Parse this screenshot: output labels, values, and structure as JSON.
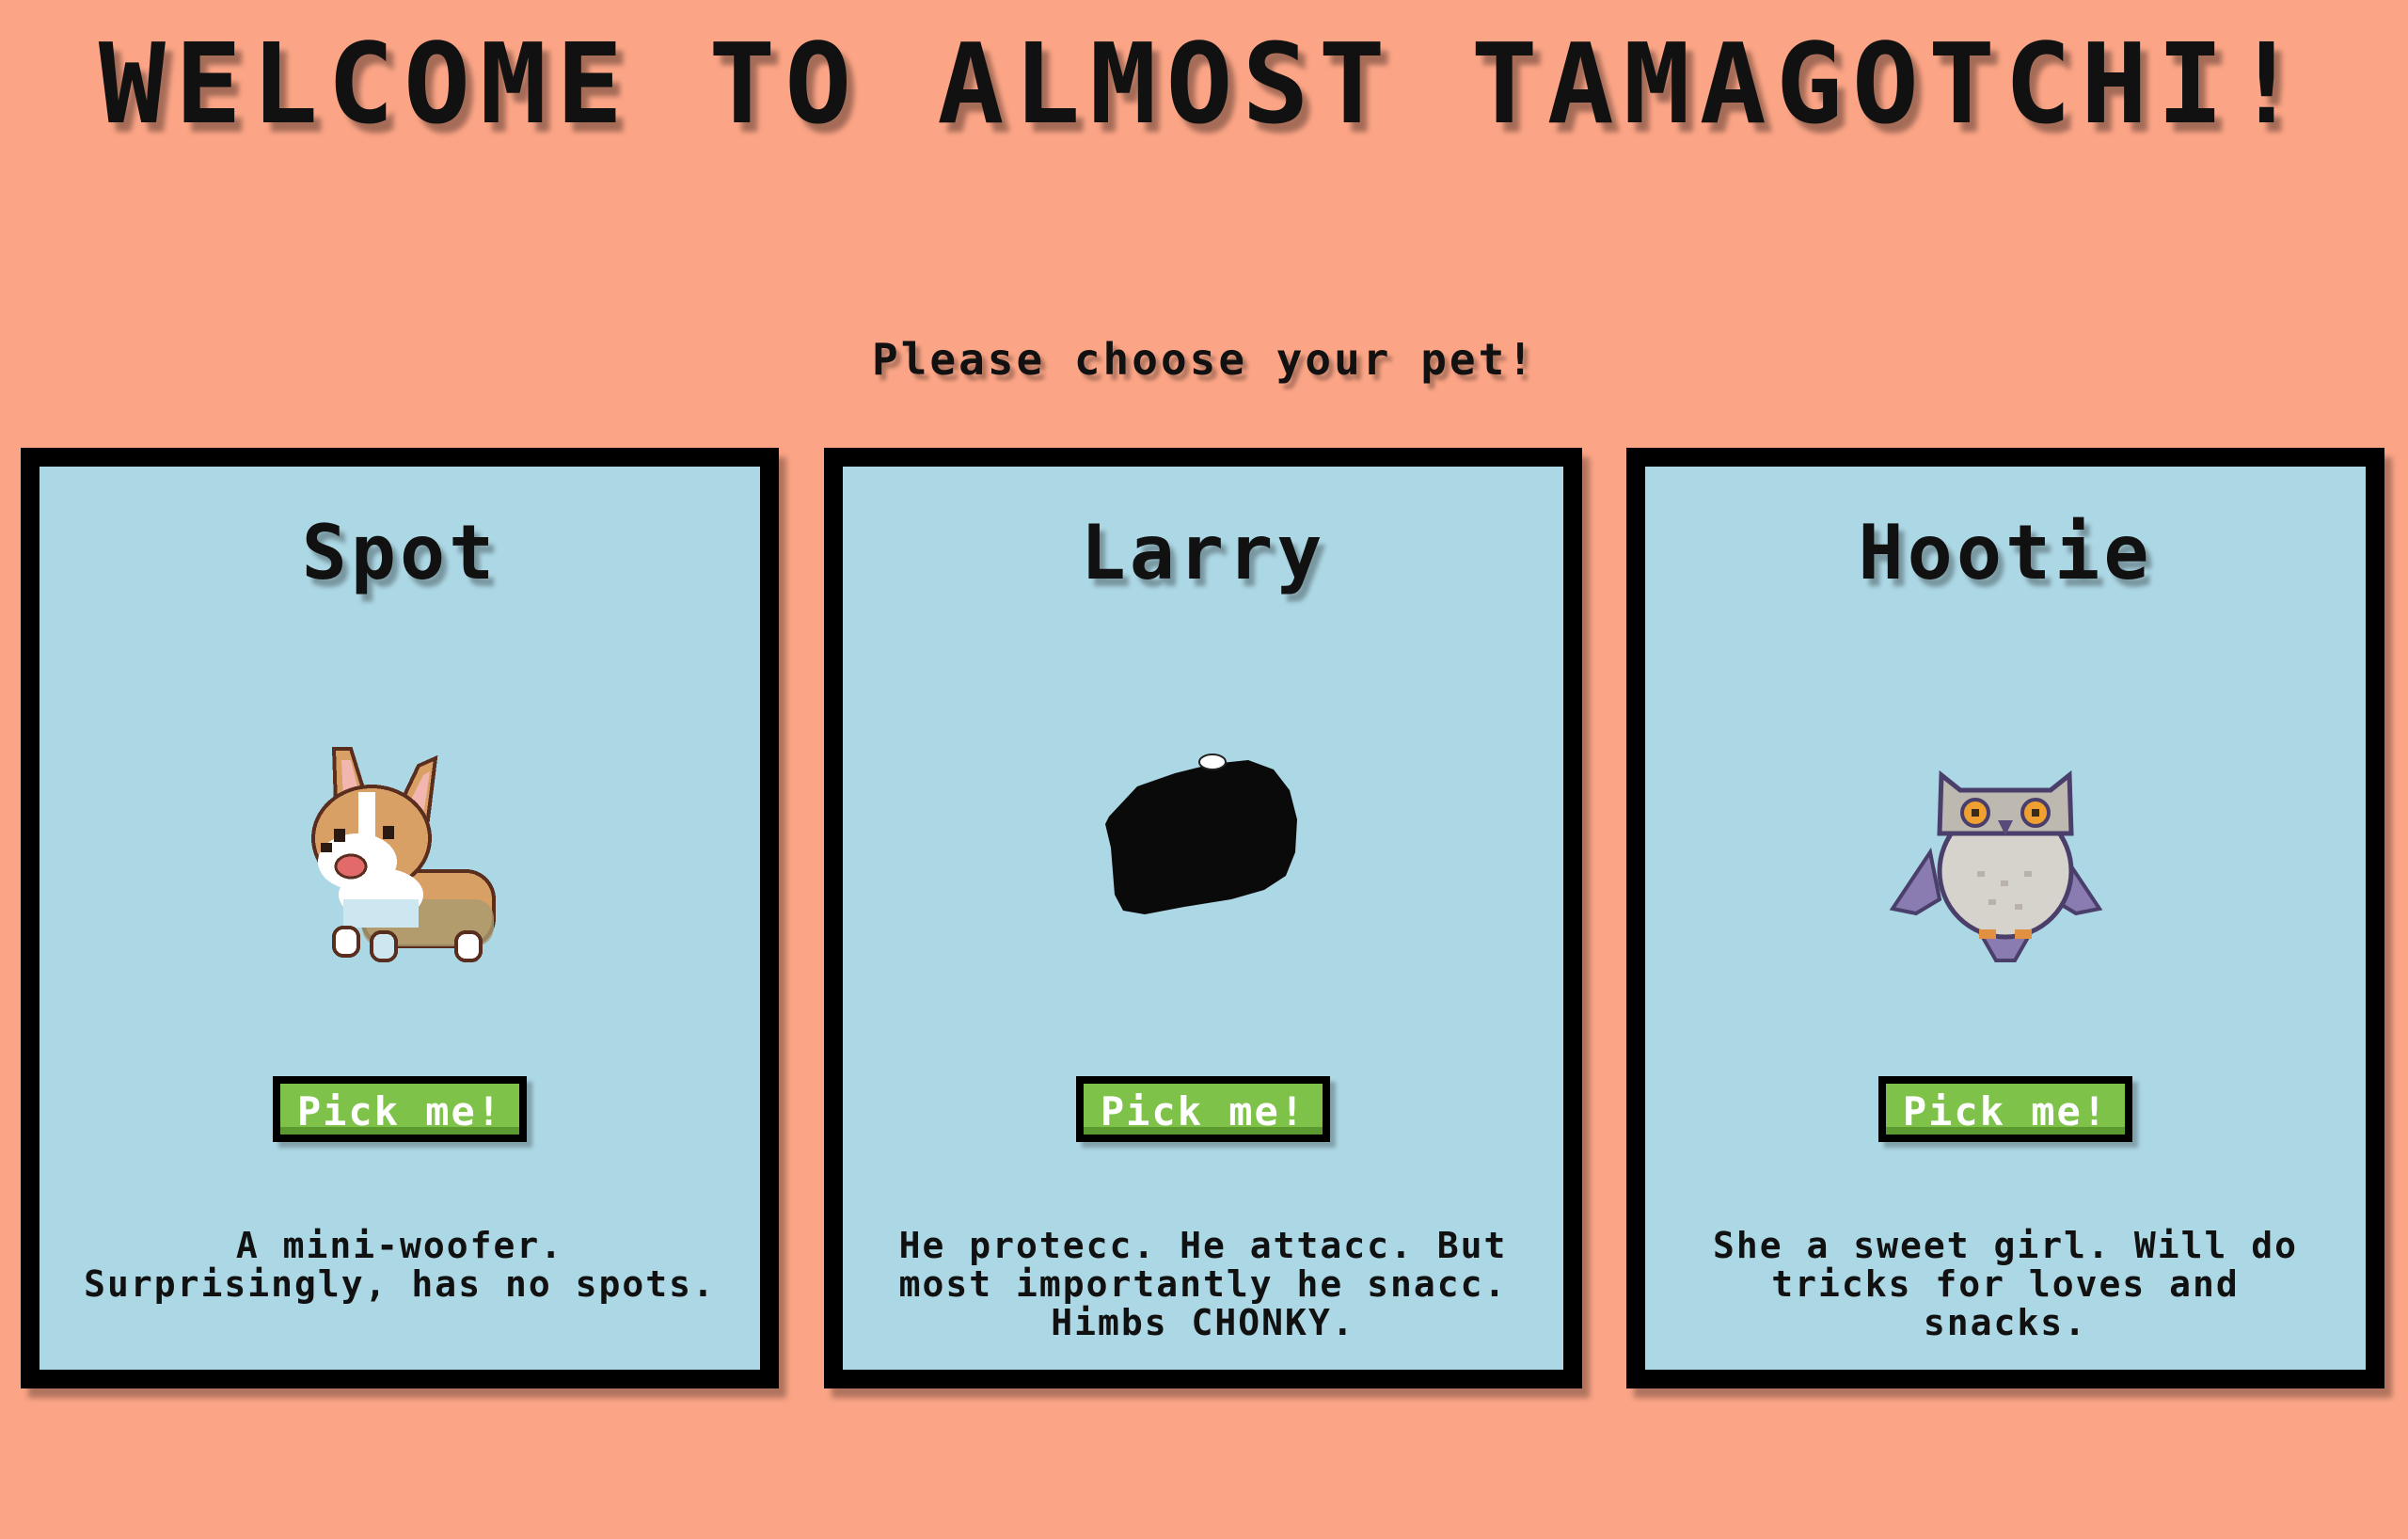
{
  "header": {
    "title": "WELCOME TO ALMOST TAMAGOTCHI!",
    "subtitle": "Please choose your pet!"
  },
  "pets": [
    {
      "name": "Spot",
      "icon": "corgi-icon",
      "button_label": "Pick me!",
      "description": "A mini-woofer. Surprisingly, has no spots."
    },
    {
      "name": "Larry",
      "icon": "black-blob-icon",
      "button_label": "Pick me!",
      "description": "He protecc. He attacc. But most importantly he snacc. Himbs CHONKY."
    },
    {
      "name": "Hootie",
      "icon": "owl-icon",
      "button_label": "Pick me!",
      "description": "She a sweet girl. Will do tricks for loves and snacks."
    }
  ],
  "colors": {
    "background": "#fca586",
    "card": "#acd7e4",
    "button": "#7ec24a",
    "border": "#000000"
  }
}
